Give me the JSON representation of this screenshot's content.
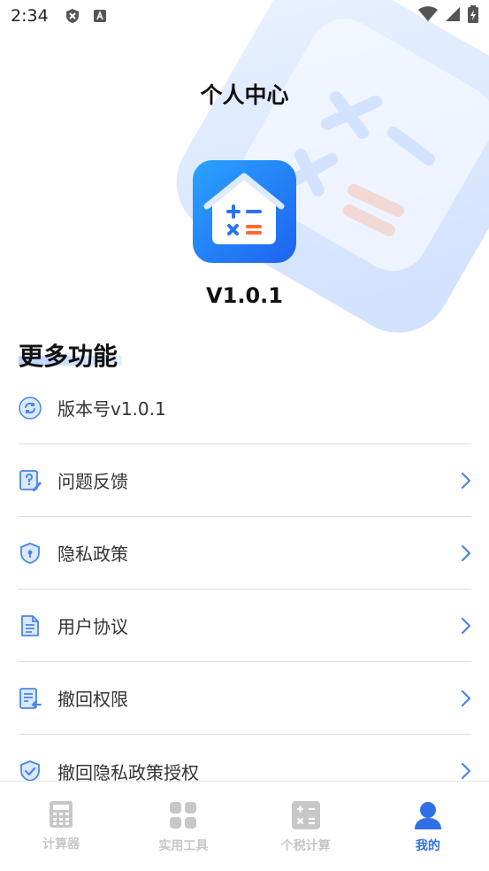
{
  "status_bar": {
    "time": "2:34"
  },
  "header": {
    "title": "个人中心",
    "version": "V1.0.1"
  },
  "section": {
    "title": "更多功能"
  },
  "menu": {
    "items": [
      {
        "label": "版本号v1.0.1",
        "icon": "refresh-icon",
        "has_chevron": false
      },
      {
        "label": "问题反馈",
        "icon": "feedback-question-icon",
        "has_chevron": true
      },
      {
        "label": "隐私政策",
        "icon": "shield-lock-icon",
        "has_chevron": true
      },
      {
        "label": "用户协议",
        "icon": "document-icon",
        "has_chevron": true
      },
      {
        "label": "撤回权限",
        "icon": "revoke-list-icon",
        "has_chevron": true
      },
      {
        "label": "撤回隐私政策授权",
        "icon": "shield-check-icon",
        "has_chevron": true
      }
    ]
  },
  "tabs": [
    {
      "label": "计算器",
      "icon": "calculator-icon",
      "active": false
    },
    {
      "label": "实用工具",
      "icon": "grid-tools-icon",
      "active": false
    },
    {
      "label": "个税计算",
      "icon": "tax-calc-icon",
      "active": false
    },
    {
      "label": "我的",
      "icon": "person-icon",
      "active": true
    }
  ],
  "colors": {
    "accent": "#2f6fe6",
    "icon_blue": "#4a86e8",
    "tab_inactive": "#c7c7c7",
    "divider": "#dcdcdc"
  }
}
